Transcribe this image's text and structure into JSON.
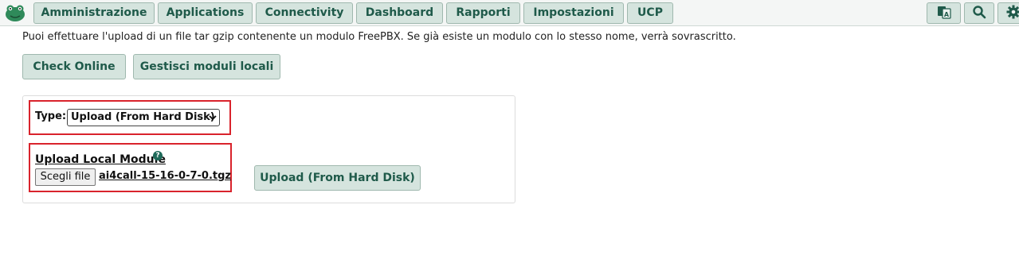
{
  "nav": {
    "items": [
      {
        "label": "Amministrazione"
      },
      {
        "label": "Applications"
      },
      {
        "label": "Connectivity"
      },
      {
        "label": "Dashboard"
      },
      {
        "label": "Rapporti"
      },
      {
        "label": "Impostazioni"
      },
      {
        "label": "UCP"
      }
    ],
    "icons": [
      "language-icon",
      "search-icon",
      "gear-icon"
    ]
  },
  "main": {
    "intro": "Puoi effettuare l'upload di un file tar gzip contenente un modulo FreePBX. Se già esiste un modulo con lo stesso nome, verrà sovrascritto.",
    "check_online_label": "Check Online",
    "manage_local_label": "Gestisci moduli locali"
  },
  "form": {
    "type_label": "Type:",
    "type_value": "Upload (From Hard Disk)",
    "module_label": "Upload Local Module",
    "help_glyph": "?",
    "choose_file_label": "Scegli file",
    "file_name": "ai4call-15-16-0-7-0.tgz",
    "upload_button_label": "Upload (From Hard Disk)"
  },
  "colors": {
    "accent": "#1f5a4a",
    "button_bg": "#d5e4de",
    "highlight": "#d9232c"
  }
}
